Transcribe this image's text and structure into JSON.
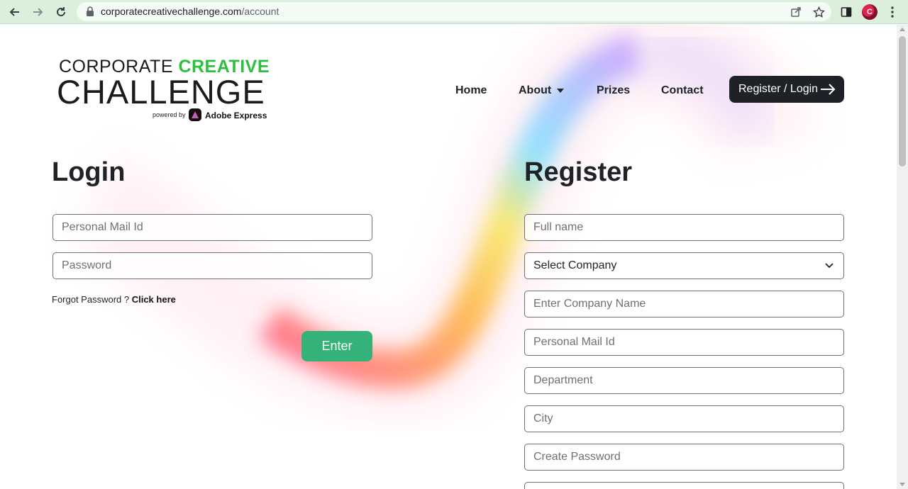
{
  "browser": {
    "url_domain": "corporatecreativechallenge.com",
    "url_path": "/account",
    "avatar_initial": "C"
  },
  "logo": {
    "line1_part1": "CORPORATE ",
    "line1_part2": "CREATIVE",
    "line2": "CHALLENGE",
    "powered_by": "powered by",
    "partner": "Adobe Express"
  },
  "nav": {
    "home": "Home",
    "about": "About",
    "prizes": "Prizes",
    "contact": "Contact",
    "register_login": "Register / Login"
  },
  "login": {
    "title": "Login",
    "email_placeholder": "Personal Mail Id",
    "password_placeholder": "Password",
    "forgot_text": "Forgot Password ? ",
    "forgot_link": "Click here",
    "submit": "Enter"
  },
  "register": {
    "title": "Register",
    "full_name_placeholder": "Full name",
    "company_select": "Select Company",
    "company_name_placeholder": "Enter Company Name",
    "email_placeholder": "Personal Mail Id",
    "department_placeholder": "Department",
    "city_placeholder": "City",
    "password_placeholder": "Create Password"
  },
  "colors": {
    "accent_green": "#34b27a",
    "logo_green": "#2fbf3f",
    "dark_button": "#1e2226"
  },
  "icons": [
    "back-icon",
    "forward-icon",
    "reload-icon",
    "lock-icon",
    "share-icon",
    "star-icon",
    "sidepanel-icon",
    "menu-icon",
    "arrow-right-icon",
    "chevron-down-icon"
  ]
}
